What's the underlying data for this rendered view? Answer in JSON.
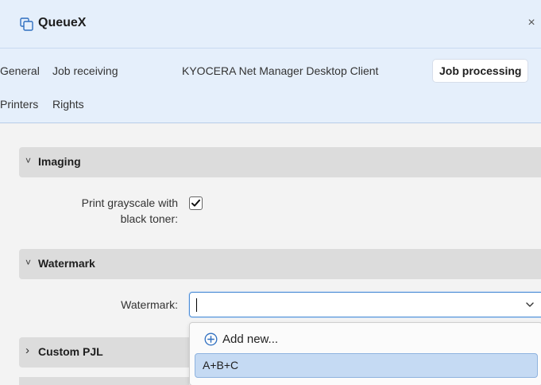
{
  "window": {
    "title": "QueueX",
    "close_label": "×"
  },
  "tabs": [
    {
      "label": "General",
      "active": false
    },
    {
      "label": "Job receiving",
      "active": false
    },
    {
      "label": "KYOCERA Net Manager Desktop Client",
      "active": false
    },
    {
      "label": "Job processing",
      "active": true
    },
    {
      "label": "Printers",
      "active": false
    },
    {
      "label": "Rights",
      "active": false
    }
  ],
  "sections": {
    "imaging": {
      "chevron": "˅",
      "label": "Imaging",
      "expanded": true,
      "fields": {
        "print_grayscale_label_line1": "Print grayscale with",
        "print_grayscale_label_line2": "black toner:",
        "print_grayscale_checked": true
      }
    },
    "watermark": {
      "chevron": "˅",
      "label": "Watermark",
      "expanded": true,
      "fields": {
        "watermark_label": "Watermark:",
        "watermark_value": ""
      }
    },
    "custom_pjl": {
      "chevron": "›",
      "label": "Custom PJL",
      "expanded": false
    }
  },
  "dropdown": {
    "add_new_label": "Add new...",
    "options": [
      "A+B+C"
    ]
  },
  "icons": {
    "title": "copy-windows-icon",
    "close": "close-icon",
    "select_chevron": "chevron-down-icon",
    "add": "plus-circle-icon",
    "checkbox": "checkmark-icon"
  },
  "colors": {
    "header_bg": "#e5effb",
    "section_bg": "#dcdcdc",
    "accent": "#2f6fc0",
    "selected_option_bg": "#c5daf3"
  }
}
